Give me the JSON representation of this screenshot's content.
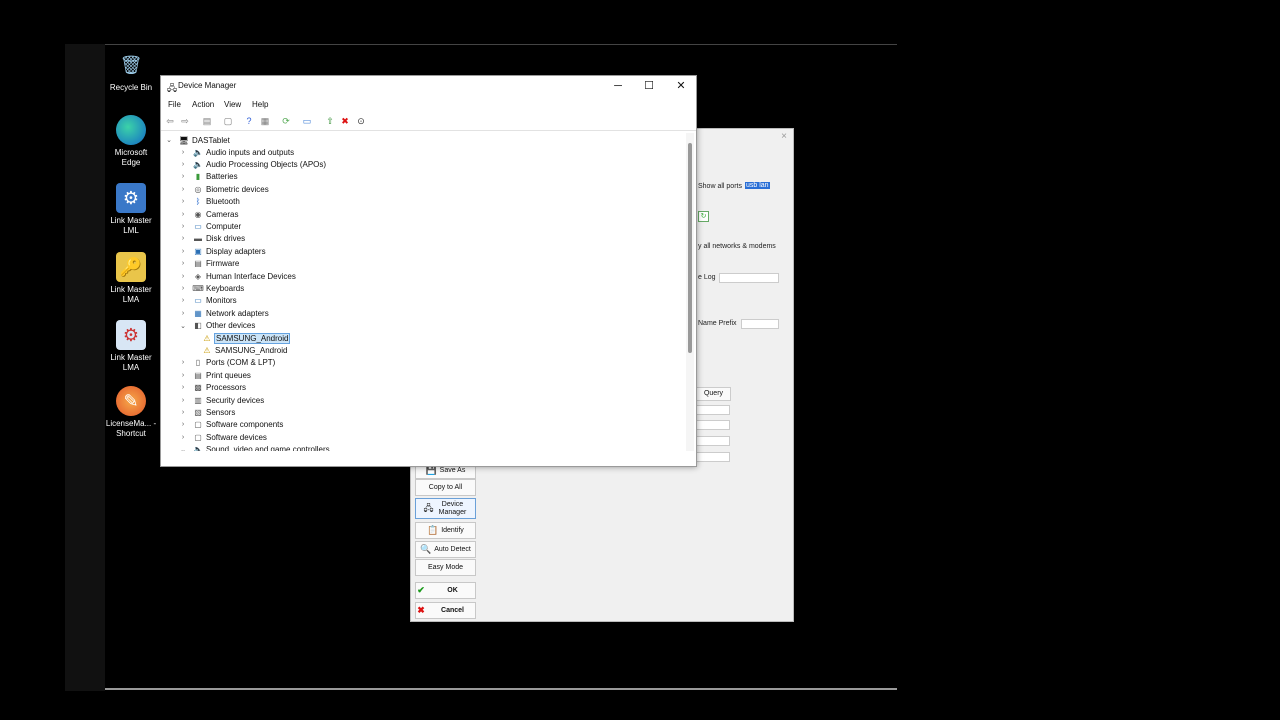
{
  "desktop": {
    "icons": [
      {
        "label": "Recycle Bin",
        "icon": "recycle-bin-icon"
      },
      {
        "label": "Microsoft Edge",
        "icon": "edge-icon"
      },
      {
        "label": "Link Master LML",
        "icon": "link-master-lml-icon"
      },
      {
        "label": "Link Master LMA",
        "icon": "link-master-lma-folder-icon"
      },
      {
        "label": "Link Master LMA",
        "icon": "link-master-lma-icon"
      },
      {
        "label": "LicenseMa... - Shortcut",
        "icon": "license-manager-shortcut-icon"
      }
    ]
  },
  "bg_dialog": {
    "close": "×",
    "show_all_ports": "Show all ports",
    "show_all_ports_field": "usb lan",
    "networks_text": "y all networks & modems",
    "log_label": "e Log",
    "name_prefix_label": "Name Prefix",
    "query_label": "Query",
    "buttons": {
      "save_as": "Save As",
      "copy_to_all": "Copy to All",
      "device_manager": "Device Manager",
      "identify": "Identify",
      "auto_detect": "Auto Detect",
      "easy_mode": "Easy Mode",
      "ok": "OK",
      "cancel": "Cancel"
    }
  },
  "device_manager": {
    "title": "Device Manager",
    "window_controls": {
      "minimize": "─",
      "maximize": "☐",
      "close": "✕"
    },
    "menu": [
      "File",
      "Action",
      "View",
      "Help"
    ],
    "root": "DASTablet",
    "categories": [
      {
        "label": "Audio inputs and outputs",
        "icon": "speaker-icon",
        "expanded": false
      },
      {
        "label": "Audio Processing Objects (APOs)",
        "icon": "speaker-icon",
        "expanded": false
      },
      {
        "label": "Batteries",
        "icon": "battery-icon",
        "expanded": false
      },
      {
        "label": "Biometric devices",
        "icon": "fingerprint-icon",
        "expanded": false
      },
      {
        "label": "Bluetooth",
        "icon": "bluetooth-icon",
        "expanded": false
      },
      {
        "label": "Cameras",
        "icon": "camera-icon",
        "expanded": false
      },
      {
        "label": "Computer",
        "icon": "computer-icon",
        "expanded": false
      },
      {
        "label": "Disk drives",
        "icon": "disk-icon",
        "expanded": false
      },
      {
        "label": "Display adapters",
        "icon": "display-adapter-icon",
        "expanded": false
      },
      {
        "label": "Firmware",
        "icon": "firmware-icon",
        "expanded": false
      },
      {
        "label": "Human Interface Devices",
        "icon": "hid-icon",
        "expanded": false
      },
      {
        "label": "Keyboards",
        "icon": "keyboard-icon",
        "expanded": false
      },
      {
        "label": "Monitors",
        "icon": "monitor-icon",
        "expanded": false
      },
      {
        "label": "Network adapters",
        "icon": "network-icon",
        "expanded": false
      },
      {
        "label": "Other devices",
        "icon": "other-devices-icon",
        "expanded": true
      },
      {
        "label": "SAMSUNG_Android",
        "icon": "warning-device-icon",
        "child": true,
        "selected": true
      },
      {
        "label": "SAMSUNG_Android",
        "icon": "warning-device-icon",
        "child": true
      },
      {
        "label": "Ports (COM & LPT)",
        "icon": "port-icon",
        "expanded": false
      },
      {
        "label": "Print queues",
        "icon": "printer-icon",
        "expanded": false
      },
      {
        "label": "Processors",
        "icon": "processor-icon",
        "expanded": false
      },
      {
        "label": "Security devices",
        "icon": "security-icon",
        "expanded": false
      },
      {
        "label": "Sensors",
        "icon": "sensor-icon",
        "expanded": false
      },
      {
        "label": "Software components",
        "icon": "software-icon",
        "expanded": false
      },
      {
        "label": "Software devices",
        "icon": "software-icon",
        "expanded": false
      },
      {
        "label": "Sound, video and game controllers",
        "icon": "speaker-icon",
        "expanded": true
      }
    ]
  }
}
